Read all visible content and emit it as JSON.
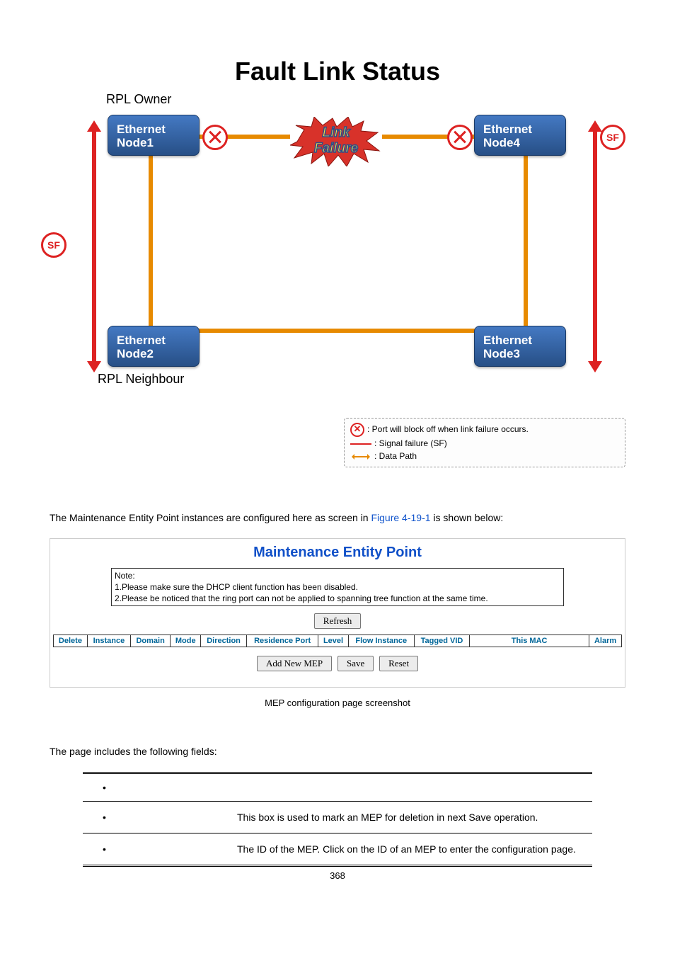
{
  "diagram": {
    "title": "Fault Link Status",
    "rpl_owner": "RPL Owner",
    "rpl_neighbour": "RPL Neighbour",
    "sf_label": "SF",
    "node1": "Ethernet\nNode1",
    "node2": "Ethernet\nNode2",
    "node3": "Ethernet\nNode3",
    "node4": "Ethernet\nNode4",
    "link_failure_l1": "Link",
    "link_failure_l2": "Failure",
    "legend": {
      "block": ": Port will block off when link failure occurs.",
      "sf": ": Signal failure (SF)",
      "data": ": Data Path"
    }
  },
  "intro_pre": "The Maintenance Entity Point instances are configured here as screen in ",
  "intro_link": "Figure 4-19-1",
  "intro_post": " is shown below:",
  "panel": {
    "title": "Maintenance Entity Point",
    "note_label": "Note:",
    "note1": "1.Please make sure the DHCP client function has been disabled.",
    "note2": "2.Please be noticed that the ring port can not be applied to spanning tree function at the same time.",
    "refresh": "Refresh",
    "headers": [
      "Delete",
      "Instance",
      "Domain",
      "Mode",
      "Direction",
      "Residence Port",
      "Level",
      "Flow Instance",
      "Tagged VID",
      "This MAC",
      "Alarm"
    ],
    "add": "Add New MEP",
    "save": "Save",
    "reset": "Reset"
  },
  "caption": "MEP configuration page screenshot",
  "fields_intro": "The page includes the following fields:",
  "fields": [
    {
      "desc": "This box is used to mark an MEP for deletion in next Save operation."
    },
    {
      "desc": "The ID of the MEP. Click on the ID of an MEP to enter the configuration page."
    }
  ],
  "page_number": "368"
}
